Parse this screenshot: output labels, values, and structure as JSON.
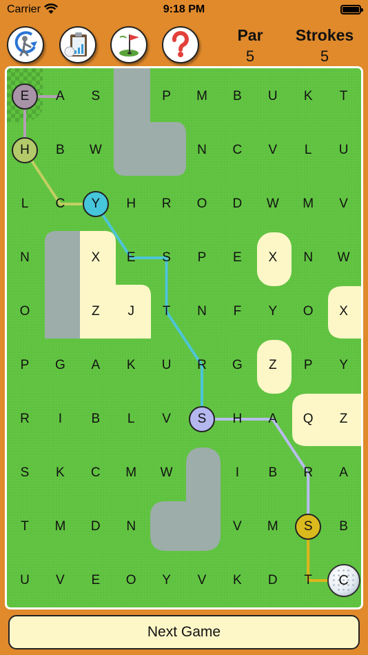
{
  "status_bar": {
    "carrier": "Carrier",
    "time": "9:18 PM"
  },
  "toolbar": {
    "buttons": [
      {
        "name": "reset-game-button",
        "icon": "golf-swing-icon"
      },
      {
        "name": "stats-button",
        "icon": "chart-clipboard-icon"
      },
      {
        "name": "course-button",
        "icon": "golf-flag-icon"
      },
      {
        "name": "help-button",
        "icon": "question-mark-icon"
      }
    ]
  },
  "score": {
    "par_label": "Par",
    "par_value": "5",
    "strokes_label": "Strokes",
    "strokes_value": "5"
  },
  "board": {
    "rows": [
      [
        "E",
        "A",
        "S",
        "",
        "P",
        "M",
        "B",
        "U",
        "K",
        "T"
      ],
      [
        "H",
        "B",
        "W",
        "",
        "",
        "N",
        "C",
        "V",
        "L",
        "U"
      ],
      [
        "L",
        "C",
        "Y",
        "H",
        "R",
        "O",
        "D",
        "W",
        "M",
        "V"
      ],
      [
        "N",
        "",
        "X",
        "E",
        "S",
        "P",
        "E",
        "X",
        "N",
        "W"
      ],
      [
        "O",
        "",
        "Z",
        "J",
        "T",
        "N",
        "F",
        "Y",
        "O",
        "X"
      ],
      [
        "P",
        "G",
        "A",
        "K",
        "U",
        "R",
        "G",
        "Z",
        "P",
        "Y"
      ],
      [
        "R",
        "I",
        "B",
        "L",
        "V",
        "S",
        "H",
        "A",
        "Q",
        "Z"
      ],
      [
        "S",
        "K",
        "C",
        "M",
        "W",
        "",
        "I",
        "B",
        "R",
        "A"
      ],
      [
        "T",
        "M",
        "D",
        "N",
        "",
        "",
        "V",
        "M",
        "S",
        "B"
      ],
      [
        "U",
        "V",
        "E",
        "O",
        "Y",
        "V",
        "K",
        "D",
        "T",
        "C"
      ]
    ],
    "marked": [
      {
        "row": 0,
        "col": 0,
        "color": "#a893a8"
      },
      {
        "row": 1,
        "col": 0,
        "color": "#b3ca6a"
      },
      {
        "row": 2,
        "col": 2,
        "color": "#46c6da"
      },
      {
        "row": 6,
        "col": 5,
        "color": "#b5b7ef"
      },
      {
        "row": 8,
        "col": 8,
        "color": "#dbba1e"
      }
    ],
    "ball": {
      "row": 9,
      "col": 9
    },
    "paths": [
      {
        "color": "#b4a0b6",
        "points": [
          [
            0,
            1
          ],
          [
            0,
            0
          ],
          [
            1,
            0
          ]
        ]
      },
      {
        "color": "#c2cf62",
        "points": [
          [
            1,
            0
          ],
          [
            2,
            1
          ],
          [
            2,
            2
          ]
        ]
      },
      {
        "color": "#4ec4d6",
        "points": [
          [
            2,
            2
          ],
          [
            3,
            3
          ],
          [
            3,
            4
          ],
          [
            4,
            4
          ],
          [
            5,
            5
          ],
          [
            6,
            5
          ]
        ]
      },
      {
        "color": "#b9bcef",
        "points": [
          [
            6,
            5
          ],
          [
            6,
            6
          ],
          [
            6,
            7
          ],
          [
            7,
            8
          ],
          [
            8,
            8
          ]
        ]
      },
      {
        "color": "#e0b51c",
        "points": [
          [
            8,
            8
          ],
          [
            9,
            8
          ],
          [
            9,
            9
          ]
        ]
      }
    ],
    "terrain_colors": {
      "fairway": "#5fc23f",
      "sand": "#fdf7c8",
      "water": "#9cadaa",
      "tee": "#51a438"
    }
  },
  "next_game_label": "Next Game"
}
